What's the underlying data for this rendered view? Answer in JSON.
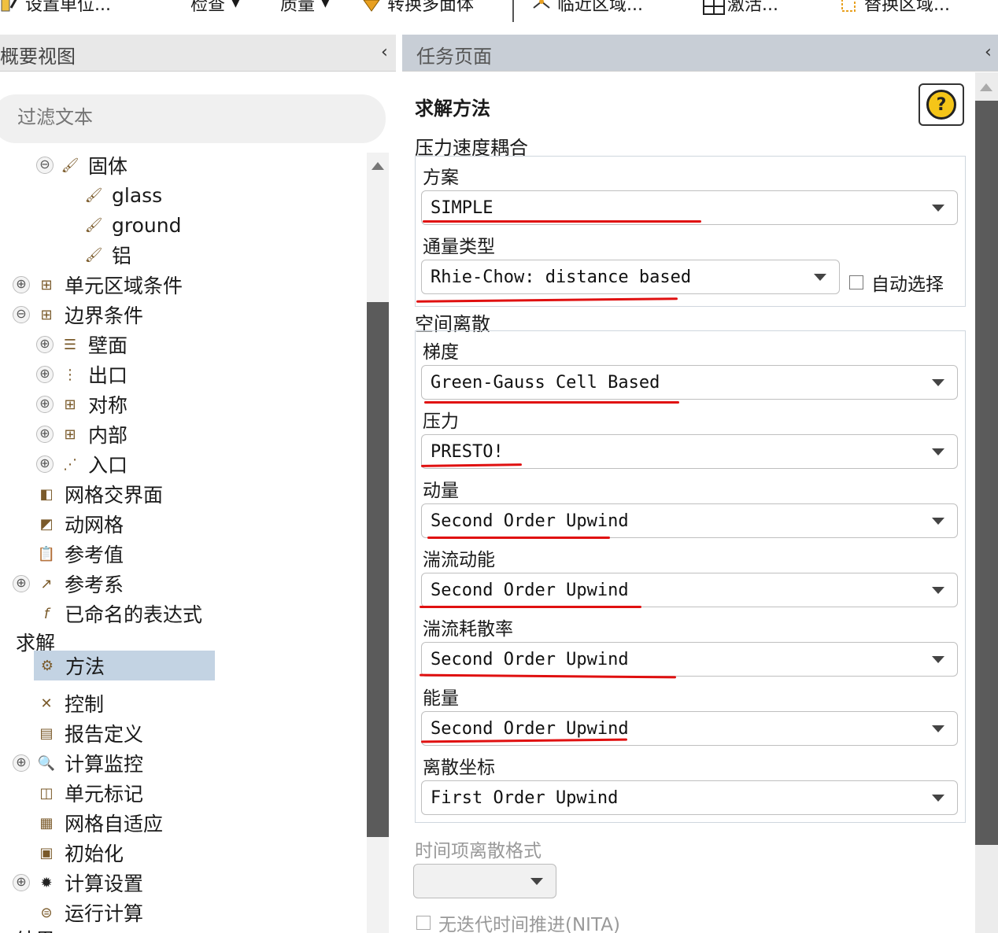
{
  "toolbar": {
    "items": [
      {
        "label": "设置单位...",
        "icon": "units-icon"
      },
      {
        "label": "检查",
        "icon": "chevron-down-icon"
      },
      {
        "label": "质量",
        "icon": "chevron-down-icon"
      },
      {
        "label": "转换多面体",
        "icon": "polyhedra-icon"
      },
      {
        "label": "临近区域...",
        "icon": "adjacency-icon"
      },
      {
        "label": "激活...",
        "icon": "grid-icon"
      },
      {
        "label": "替换区域...",
        "icon": "replace-zone-icon"
      }
    ]
  },
  "outline": {
    "title": "概要视图",
    "filter_placeholder": "过滤文本",
    "tree": [
      {
        "label": "固体",
        "icon": "solid-material-icon",
        "expander": "⊖"
      },
      {
        "label": "glass",
        "icon": "solid-material-icon"
      },
      {
        "label": "ground",
        "icon": "solid-material-icon"
      },
      {
        "label": "铝",
        "icon": "solid-material-icon"
      },
      {
        "label": "单元区域条件",
        "icon": "cell-zone-icon",
        "expander": "⊕"
      },
      {
        "label": "边界条件",
        "icon": "boundary-icon",
        "expander": "⊖"
      },
      {
        "label": "壁面",
        "icon": "wall-icon",
        "expander": "⊕"
      },
      {
        "label": "出口",
        "icon": "outlet-icon",
        "expander": "⊕"
      },
      {
        "label": "对称",
        "icon": "symmetry-icon",
        "expander": "⊕"
      },
      {
        "label": "内部",
        "icon": "interior-icon",
        "expander": "⊕"
      },
      {
        "label": "入口",
        "icon": "inlet-icon",
        "expander": "⊕"
      },
      {
        "label": "网格交界面",
        "icon": "mesh-interface-icon"
      },
      {
        "label": "动网格",
        "icon": "dynamic-mesh-icon"
      },
      {
        "label": "参考值",
        "icon": "reference-values-icon"
      },
      {
        "label": "参考系",
        "icon": "reference-frame-icon",
        "expander": "⊕"
      },
      {
        "label": "已命名的表达式",
        "icon": "expression-icon"
      },
      {
        "label": "求解"
      },
      {
        "label": "方法",
        "icon": "methods-icon",
        "selected": true
      },
      {
        "label": "控制",
        "icon": "controls-icon"
      },
      {
        "label": "报告定义",
        "icon": "report-definitions-icon"
      },
      {
        "label": "计算监控",
        "icon": "monitors-icon",
        "expander": "⊕"
      },
      {
        "label": "单元标记",
        "icon": "cell-registers-icon"
      },
      {
        "label": "网格自适应",
        "icon": "mesh-adaption-icon"
      },
      {
        "label": "初始化",
        "icon": "initialization-icon"
      },
      {
        "label": "计算设置",
        "icon": "calculation-activities-icon",
        "expander": "⊕"
      },
      {
        "label": "运行计算",
        "icon": "run-calculation-icon"
      },
      {
        "label": "结果"
      }
    ]
  },
  "task": {
    "title": "任务页面",
    "section": "求解方法",
    "coupling": {
      "group": "压力速度耦合",
      "scheme_label": "方案",
      "scheme_value": "SIMPLE",
      "flux_label": "通量类型",
      "flux_value": "Rhie-Chow: distance based",
      "auto_select": "自动选择"
    },
    "spatial": {
      "group": "空间离散",
      "fields": [
        {
          "label": "梯度",
          "value": "Green-Gauss Cell Based"
        },
        {
          "label": "压力",
          "value": "PRESTO!"
        },
        {
          "label": "动量",
          "value": "Second Order Upwind"
        },
        {
          "label": "湍流动能",
          "value": "Second Order Upwind"
        },
        {
          "label": "湍流耗散率",
          "value": "Second Order Upwind"
        },
        {
          "label": "能量",
          "value": "Second Order Upwind"
        },
        {
          "label": "离散坐标",
          "value": "First Order Upwind"
        }
      ]
    },
    "transient_label": "时间项离散格式",
    "transient_value": "",
    "nita": "无迭代时间推进(NITA)"
  },
  "colors": {
    "annotation": "#e01010",
    "selection": "#c3d3e3",
    "task_header": "#c8ced6"
  }
}
